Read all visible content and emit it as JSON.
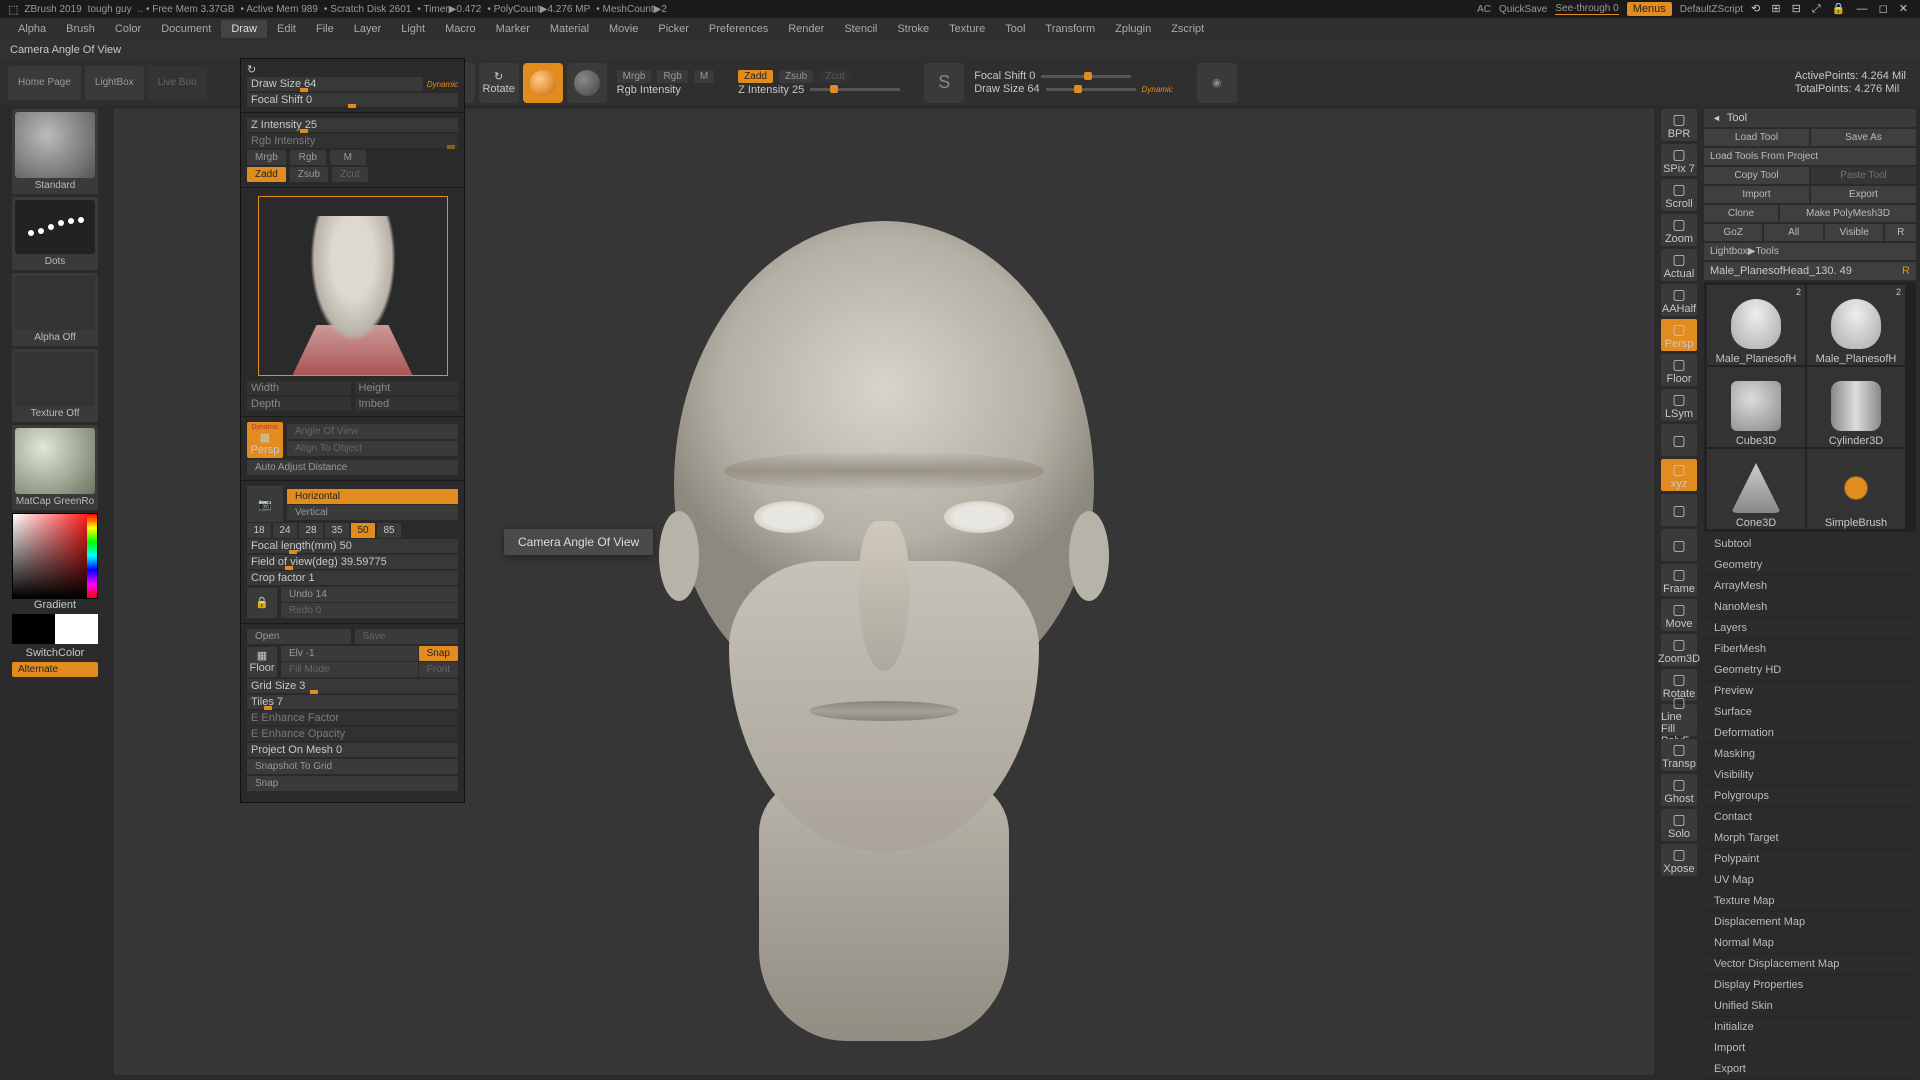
{
  "titlebar": {
    "app": "ZBrush 2019",
    "project": "tough guy",
    "free_mem": ".. • Free Mem 3.37GB",
    "active_mem": "• Active Mem 989",
    "scratch": "• Scratch Disk 2601",
    "timer": "• Timer▶0.472",
    "polycount": "• PolyCount▶4.276 MP",
    "meshcount": "• MeshCount▶2",
    "ac": "AC",
    "quicksave": "QuickSave",
    "seethrough": "See-through  0",
    "menus": "Menus",
    "zscript": "DefaultZScript"
  },
  "menubar": [
    "Alpha",
    "Brush",
    "Color",
    "Document",
    "Draw",
    "Edit",
    "File",
    "Layer",
    "Light",
    "Macro",
    "Marker",
    "Material",
    "Movie",
    "Picker",
    "Preferences",
    "Render",
    "Stencil",
    "Stroke",
    "Texture",
    "Tool",
    "Transform",
    "Zplugin",
    "Zscript"
  ],
  "menubar_active": "Draw",
  "infobar": "Camera Angle Of View",
  "toolbar": {
    "homepage": "Home Page",
    "lightbox": "LightBox",
    "liveboo": "Live Boo",
    "mrgb": "Mrgb",
    "rgb": "Rgb",
    "m": "M",
    "rgbint": "Rgb Intensity",
    "zadd": "Zadd",
    "zsub": "Zsub",
    "zcut": "Zcut",
    "zint": "Z Intensity 25",
    "focal": "Focal Shift 0",
    "drawsize": "Draw Size 64",
    "dynamic": "Dynamic",
    "active_pts": "ActivePoints: 4.264 Mil",
    "total_pts": "TotalPoints: 4.276 Mil"
  },
  "left": {
    "brush": "Standard",
    "stroke": "Dots",
    "alpha": "Alpha Off",
    "tex": "Texture Off",
    "mat": "MatCap GreenRo",
    "grad": "Gradient",
    "switch": "SwitchColor",
    "alt": "Alternate"
  },
  "draw": {
    "drawsize": "Draw Size 64",
    "focal": "Focal Shift 0",
    "dynamic": "Dynamic",
    "zint": "Z Intensity 25",
    "rgbint": "Rgb Intensity",
    "mrgb": "Mrgb",
    "rgb": "Rgb",
    "m": "M",
    "zadd": "Zadd",
    "zsub": "Zsub",
    "zcut": "Zcut",
    "width": "Width",
    "height": "Height",
    "depth": "Depth",
    "imbed": "Imbed",
    "aov": "Angle Of View",
    "align": "Align To Object",
    "auto": "Auto Adjust Distance",
    "horiz": "Horizontal",
    "vert": "Vertical",
    "lenses": [
      "18",
      "24",
      "28",
      "35",
      "50",
      "85"
    ],
    "lens_sel": "50",
    "focal_len": "Focal length(mm) 50",
    "fov": "Field of view(deg) 39.59775",
    "crop": "Crop factor 1",
    "undo": "Undo 14",
    "redo": "Redo 0",
    "open": "Open",
    "save": "Save",
    "elv": "Elv -1",
    "snap": "Snap",
    "fill": "Fill Mode",
    "front": "Front",
    "floor": "Floor",
    "grid": "Grid Size 3",
    "tiles": "Tiles 7",
    "ef": "E Enhance Factor",
    "eo": "E Enhance Opacity",
    "pom": "Project On Mesh 0",
    "s2g": "Snapshot To Grid",
    "snap2": "Snap"
  },
  "tooltip": "Camera Angle Of View",
  "rdock": [
    "BPR",
    "SPix 7",
    "Scroll",
    "Zoom",
    "Actual",
    "AAHalf",
    "Persp",
    "Floor",
    "LSym",
    "",
    "xyz",
    "",
    "",
    "Frame",
    "Move",
    "Zoom3D",
    "Rotate",
    "Line Fill PolyF",
    "Transp",
    "Ghost",
    "Solo",
    "Xpose"
  ],
  "rdock_on": [
    "Persp",
    "xyz"
  ],
  "tool": {
    "header": "Tool",
    "load": "Load Tool",
    "saveas": "Save As",
    "loadproj": "Load Tools From Project",
    "copy": "Copy Tool",
    "paste": "Paste Tool",
    "import": "Import",
    "export": "Export",
    "clone": "Clone",
    "makepoly": "Make PolyMesh3D",
    "goz": "GoZ",
    "all": "All",
    "visible": "Visible",
    "r": "R",
    "lightbox": "Lightbox▶Tools",
    "current": "Male_PlanesofHead_130. 49",
    "thumbs": [
      {
        "label": "Male_PlanesofH",
        "count": "2",
        "kind": "head"
      },
      {
        "label": "Male_PlanesofH",
        "count": "2",
        "kind": "head"
      },
      {
        "label": "Cube3D",
        "count": "",
        "kind": "cube"
      },
      {
        "label": "Cylinder3D",
        "count": "",
        "kind": "cyl"
      },
      {
        "label": "Cone3D",
        "count": "",
        "kind": "cone"
      },
      {
        "label": "SimpleBrush",
        "count": "",
        "kind": "brush"
      }
    ],
    "sections": [
      "Subtool",
      "Geometry",
      "ArrayMesh",
      "NanoMesh",
      "Layers",
      "FiberMesh",
      "Geometry HD",
      "Preview",
      "Surface",
      "Deformation",
      "Masking",
      "Visibility",
      "Polygroups",
      "Contact",
      "Morph Target",
      "Polypaint",
      "UV Map",
      "Texture Map",
      "Displacement Map",
      "Normal Map",
      "Vector Displacement Map",
      "Display Properties",
      "Unified Skin",
      "Initialize",
      "Import",
      "Export"
    ]
  }
}
